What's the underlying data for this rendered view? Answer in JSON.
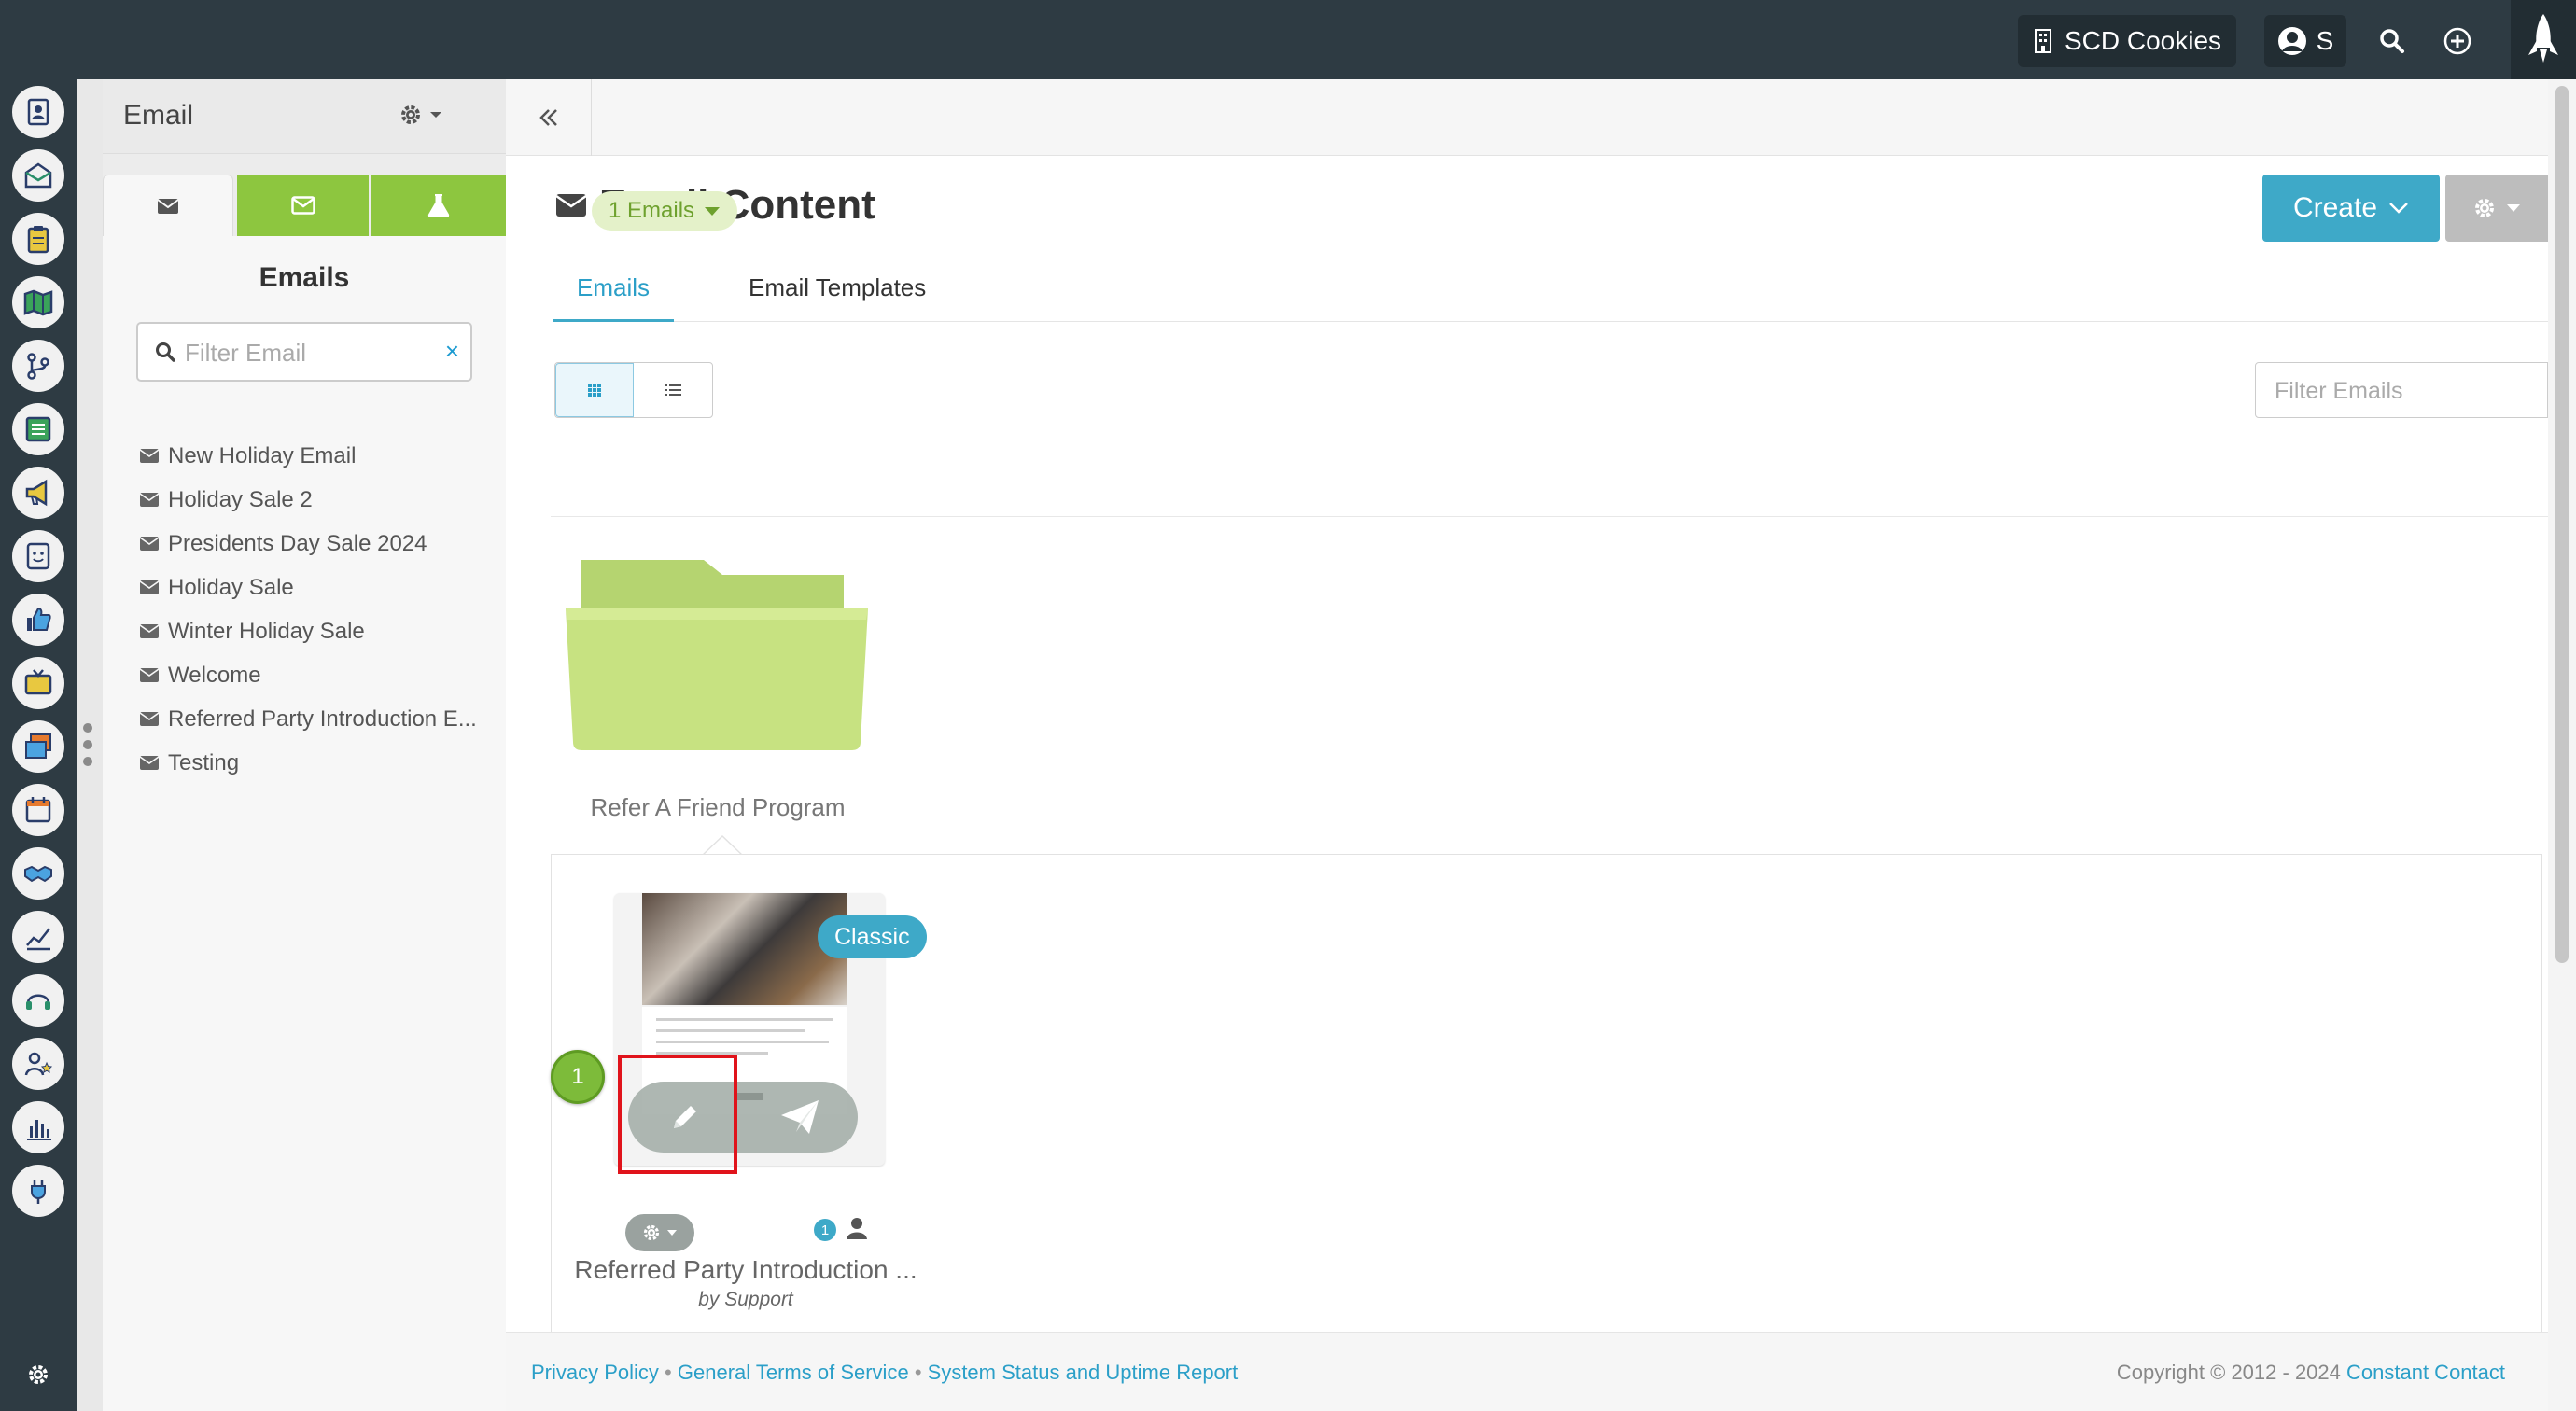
{
  "topbar": {
    "account_label": "SCD Cookies",
    "user_initial": "S"
  },
  "rail": {
    "icons": [
      "contacts-icon",
      "inbox-icon",
      "clipboard-icon",
      "map-icon",
      "workflow-icon",
      "list-icon",
      "megaphone-icon",
      "survey-icon",
      "thumbs-up-icon",
      "tv-icon",
      "media-icon",
      "calendar-icon",
      "handshake-icon",
      "growth-chart-icon",
      "headset-icon",
      "user-star-icon",
      "bar-chart-icon",
      "plug-icon",
      "settings-gear-icon"
    ]
  },
  "sidebar": {
    "title": "Email",
    "panel_title": "Emails",
    "filter_placeholder": "Filter Email",
    "items": [
      {
        "label": "New Holiday Email"
      },
      {
        "label": "Holiday Sale 2"
      },
      {
        "label": "Presidents Day Sale 2024"
      },
      {
        "label": "Holiday Sale"
      },
      {
        "label": "Winter Holiday Sale"
      },
      {
        "label": "Welcome"
      },
      {
        "label": "Referred Party Introduction E..."
      },
      {
        "label": "Testing"
      }
    ]
  },
  "main": {
    "title": "Email Content",
    "create_label": "Create",
    "tabs": [
      {
        "label": "Emails",
        "active": true
      },
      {
        "label": "Email Templates",
        "active": false
      }
    ],
    "filter_placeholder": "Filter Emails",
    "folder": {
      "badge": "1 Emails",
      "name": "Refer A Friend Program"
    },
    "card": {
      "badge": "Classic",
      "step_number": "1",
      "count": "1",
      "name": "Referred Party Introduction ...",
      "author": "by Support"
    }
  },
  "footer": {
    "privacy": "Privacy Policy",
    "terms": "General Terms of Service",
    "status": "System Status and Uptime Report",
    "separator": "•",
    "copyright": "Copyright © 2012 - 2024",
    "brand": "Constant Contact"
  },
  "colors": {
    "topbar": "#2e3b43",
    "accent_blue": "#3ea9c8",
    "accent_green": "#8dc63f",
    "highlight_red": "#e0131b"
  }
}
